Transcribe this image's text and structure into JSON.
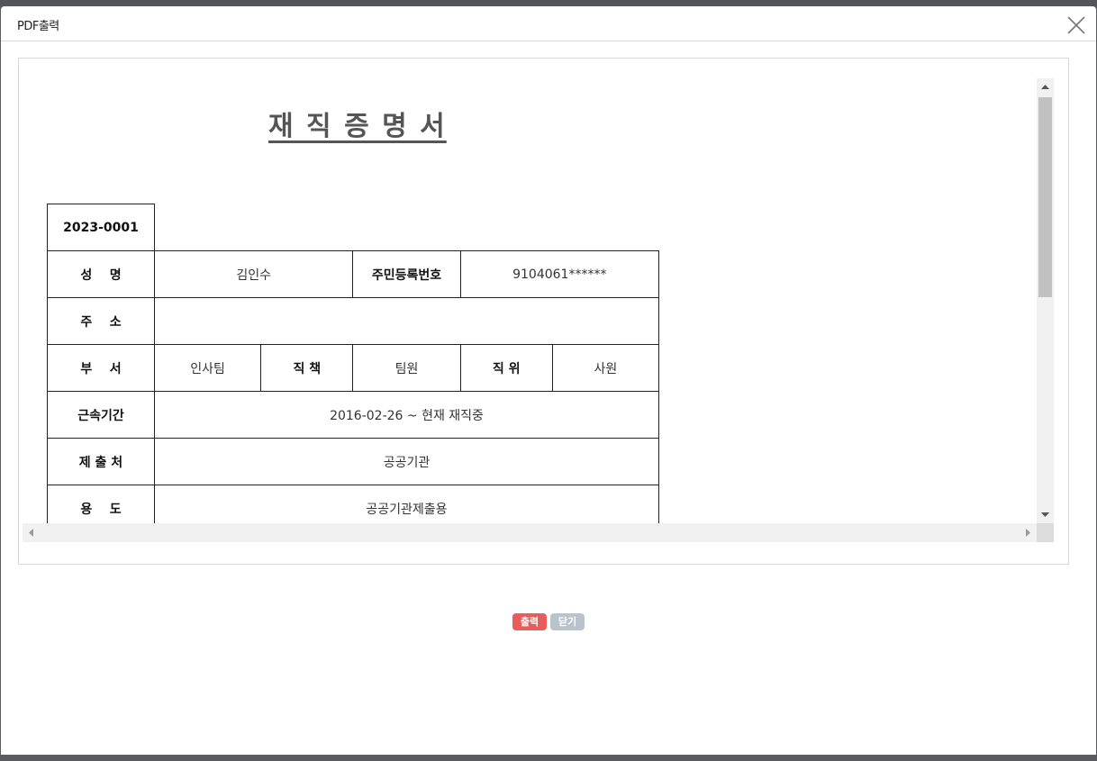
{
  "modal": {
    "title": "PDF출력",
    "close_icon": "close-icon"
  },
  "document": {
    "title": "재 직 증 명 서",
    "number": "2023-0001",
    "rows": {
      "name_label": "성    명",
      "name_value": "김인수",
      "id_label": "주민등록번호",
      "id_value": "9104061******",
      "address_label": "주    소",
      "address_value": "",
      "dept_label": "부    서",
      "dept_value": "인사팀",
      "duty_label": "직  책",
      "duty_value": "팀원",
      "position_label": "직  위",
      "position_value": "사원",
      "period_label": "근속기간",
      "period_value": "2016-02-26 ~ 현재 재직중",
      "submit_label": "제 출 처",
      "submit_value": "공공기관",
      "purpose_label": "용    도",
      "purpose_value": "공공기관제출용"
    }
  },
  "buttons": {
    "print_label": "출력",
    "close_label": "닫기"
  },
  "colors": {
    "print_button": "#e85c5c",
    "close_button": "#b9c3cc"
  }
}
